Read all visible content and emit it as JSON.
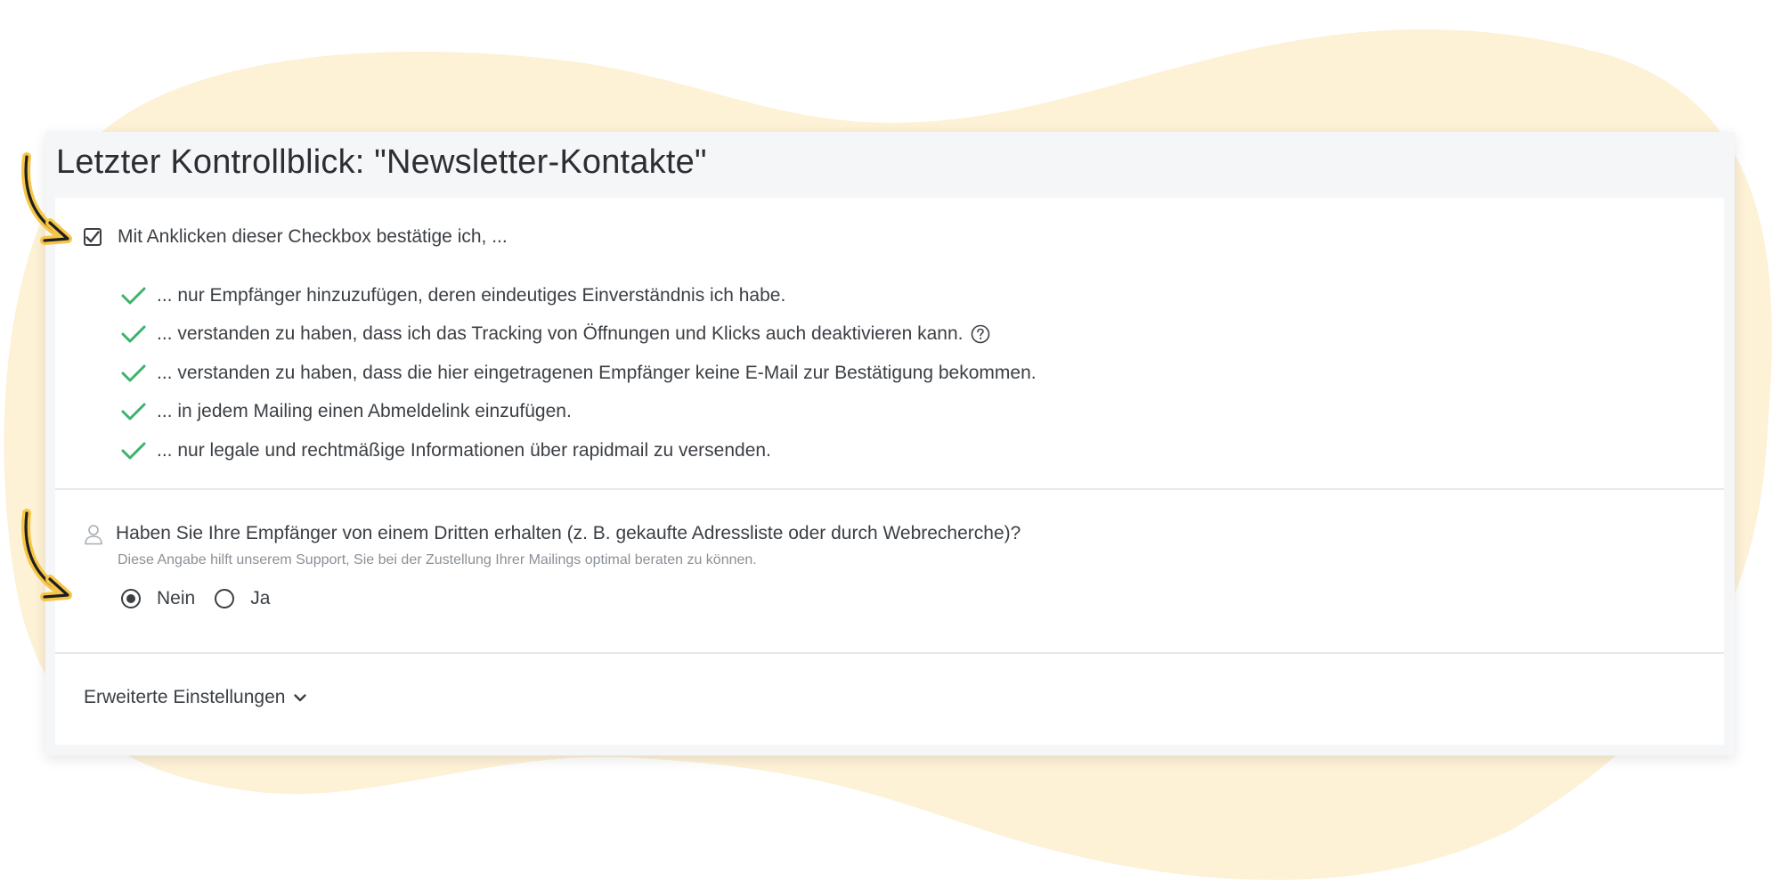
{
  "colors": {
    "background_blob": "#fdf1d6",
    "check_green": "#3bb36a",
    "arrow_yellow": "#f6c648",
    "text": "#3b3f44"
  },
  "panel": {
    "title": "Letzter Kontrollblick: \"Newsletter-Kontakte\""
  },
  "confirm": {
    "checkbox_checked": true,
    "checkbox_label": "Mit Anklicken dieser Checkbox bestätige ich, ...",
    "items": [
      {
        "text": "... nur Empfänger hinzuzufügen, deren eindeutiges Einverständnis ich habe."
      },
      {
        "text": "... verstanden zu haben, dass ich das Tracking von Öffnungen und Klicks auch deaktivieren kann.",
        "help_icon": "question-circle-icon"
      },
      {
        "text": "... verstanden zu haben, dass die hier eingetragenen Empfänger keine E-Mail zur Bestätigung bekommen."
      },
      {
        "text": "... in jedem Mailing einen Abmeldelink einzufügen."
      },
      {
        "text": "... nur legale und rechtmäßige Informationen über rapidmail zu versenden."
      }
    ]
  },
  "third_party": {
    "question": "Haben Sie Ihre Empfänger von einem Dritten erhalten (z. B. gekaufte Adressliste oder durch Webrecherche)?",
    "hint": "Diese Angabe hilft unserem Support, Sie bei der Zustellung Ihrer Mailings optimal beraten zu können.",
    "options": [
      {
        "label": "Nein",
        "selected": true
      },
      {
        "label": "Ja",
        "selected": false
      }
    ]
  },
  "advanced": {
    "label": "Erweiterte Einstellungen",
    "icon": "chevron-down-icon"
  }
}
